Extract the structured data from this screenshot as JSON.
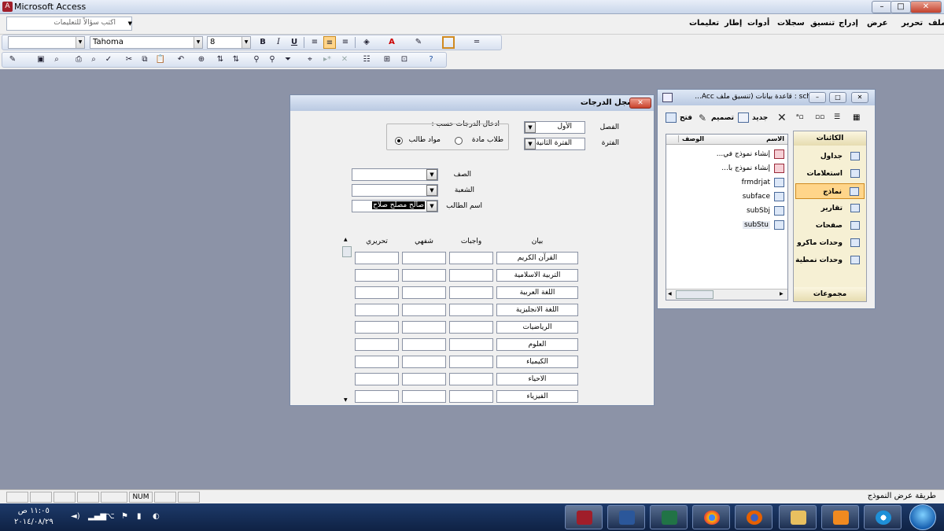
{
  "app": {
    "title": "Microsoft Access",
    "icon": "access-icon"
  },
  "window_controls": {
    "minimize": "–",
    "maximize": "□",
    "close": "✕"
  },
  "menu": {
    "items": [
      "ملف",
      "تحرير",
      "عرض",
      "إدراج",
      "تنسيق",
      "سجلات",
      "أدوات",
      "إطار",
      "تعليمات"
    ],
    "help_placeholder": "اكتب سؤالاً للتعليمات"
  },
  "formatting_toolbar": {
    "object_combo": "",
    "font": "Tahoma",
    "size": "8",
    "bold": "B",
    "italic": "I",
    "underline": "U"
  },
  "form": {
    "title": "سجل الدرجات",
    "labels": {
      "class": "الفصل",
      "period": "الفترة",
      "entry_by": "ادخال الدرجات حسب :",
      "grade": "الصف",
      "section": "الشعبة",
      "student_name": "اسم الطالب"
    },
    "values": {
      "class": "الأول",
      "period": "الفترة الثانية",
      "grade": "",
      "section": "",
      "student_name": "صالح مصلح صلاح"
    },
    "options": {
      "students_subject": "طلاب مادة",
      "student_subjects": "مواد طالب",
      "selected": "student_subjects"
    },
    "columns": {
      "subject": "بيان",
      "homework": "واجبات",
      "oral": "شفهي",
      "written": "تحريري"
    },
    "subjects": [
      "القرآن الكريم",
      "التربية الاسلامية",
      "اللغة العربية",
      "اللغة الانجليزية",
      "الرياضيات",
      "العلوم",
      "الكيمياء",
      "الاحياء",
      "الفيزياء"
    ]
  },
  "db_window": {
    "title": "sch7 : قاعدة بيانات (تنسيق ملف Acc...",
    "toolbar": {
      "open": "فتح",
      "design": "تصميم",
      "new": "جديد"
    },
    "list_headers": {
      "name": "الاسم",
      "description": "الوصف"
    },
    "objects": [
      {
        "name": "إنشاء نموذج في...",
        "icon": "wizard-icon"
      },
      {
        "name": "إنشاء نموذج با...",
        "icon": "wizard-icon"
      },
      {
        "name": "frmdrjat",
        "icon": "form-icon"
      },
      {
        "name": "subface",
        "icon": "form-icon"
      },
      {
        "name": "subSbj",
        "icon": "form-icon"
      },
      {
        "name": "subStu",
        "icon": "form-icon"
      }
    ],
    "categories_header": "الكائنات",
    "categories": [
      "جداول",
      "استعلامات",
      "نماذج",
      "تقارير",
      "صفحات",
      "وحدات ماكرو",
      "وحدات نمطية"
    ],
    "selected_category": "نماذج",
    "groups_header": "مجموعات"
  },
  "status": {
    "text": "طريقة عرض النموذج",
    "num": "NUM"
  },
  "taskbar": {
    "time": "١١:٠٥ ص",
    "date": "٢٠١٤/٠٨/٢٩"
  }
}
